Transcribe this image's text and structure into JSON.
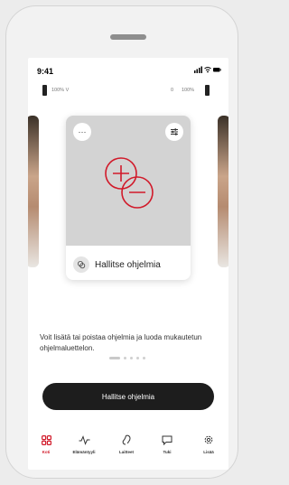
{
  "status_bar": {
    "time": "9:41",
    "system_icons": "..ıl ᯤ ▬"
  },
  "batteries": {
    "left": "100% V",
    "right_value": "0",
    "right_percent": "100%"
  },
  "program_card": {
    "label": "Hallitse ohjelmia",
    "menu_icon": "more-icon",
    "settings_icon": "sliders-icon",
    "accent_color": "#d11a2a"
  },
  "pagination": {
    "count": 5,
    "active_index": 0
  },
  "description": "Voit lisätä tai poistaa ohjelmia ja luoda mukautetun ohjelmaluettelon.",
  "primary_button": "Hallitse ohjelmia",
  "tabs": [
    {
      "label": "Koti",
      "icon": "home-grid-icon",
      "active": true
    },
    {
      "label": "Elämäntyyli",
      "icon": "activity-icon",
      "active": false
    },
    {
      "label": "Laitteet",
      "icon": "hearing-aid-icon",
      "active": false
    },
    {
      "label": "Tuki",
      "icon": "chat-icon",
      "active": false
    },
    {
      "label": "Lisää",
      "icon": "gear-icon",
      "active": false
    }
  ],
  "colors": {
    "accent": "#d11a2a",
    "button_bg": "#1d1d1d"
  }
}
